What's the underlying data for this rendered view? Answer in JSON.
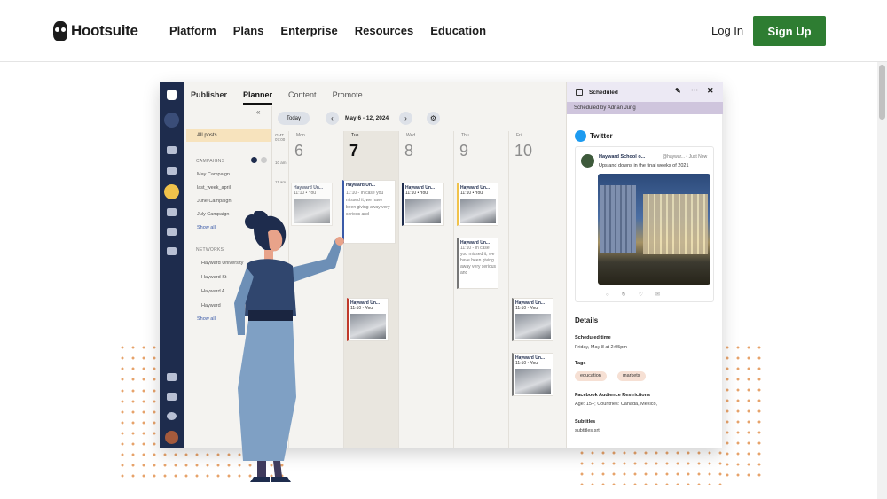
{
  "nav": {
    "brand": "Hootsuite",
    "links": [
      "Platform",
      "Plans",
      "Enterprise",
      "Resources",
      "Education"
    ],
    "login": "Log In",
    "signup": "Sign Up"
  },
  "colors": {
    "signup": "#2e7d32",
    "rail": "#1e2c4d",
    "accent_dots": "#e7a36b",
    "selected": "#f7e3bd"
  },
  "app": {
    "tabs": [
      "Publisher",
      "Planner",
      "Content",
      "Promote"
    ],
    "active_tab": "Planner",
    "toolbar": {
      "today": "Today",
      "range": "May 6 - 12, 2024"
    },
    "left": {
      "all_posts": "All posts",
      "campaigns_heading": "CAMPAIGNS",
      "campaigns": [
        "May Campaign",
        "last_week_april",
        "June Campaign",
        "July Campaign"
      ],
      "show_all_1": "Show all",
      "networks_heading": "NETWORKS",
      "networks": [
        "Hayward University",
        "Hayward St",
        "Hayward A",
        "Hayward"
      ],
      "show_all_2": "Show all"
    },
    "gmt": "GMT 07:00",
    "times": [
      "10 am",
      "11 am"
    ],
    "days": [
      {
        "name": "Mon",
        "num": "6"
      },
      {
        "name": "Tue",
        "num": "7"
      },
      {
        "name": "Wed",
        "num": "8"
      },
      {
        "name": "Thu",
        "num": "9"
      },
      {
        "name": "Fri",
        "num": "10"
      }
    ],
    "card_title": "Hayward Un...",
    "card_time": "11:10 • You",
    "card_text": "11:10 - In case you missed it, we have been giving away very serious and",
    "right": {
      "header": "Scheduled",
      "scheduled_by": "Scheduled by Adrian Jung",
      "network": "Twitter",
      "tweet_name": "Hayward School o...",
      "tweet_handle": "@haywar... • Just Now",
      "tweet_text": "Ups and downs in the final weeks of 2021",
      "details": "Details",
      "scheduled_time_label": "Scheduled time",
      "scheduled_time": "Friday, May 8 at 2:05pm",
      "tags_label": "Tags",
      "tags": [
        "education",
        "markets"
      ],
      "restrictions_label": "Facebook Audience Restrictions",
      "restrictions": "Age: 15+; Countries: Canada, Mexico,",
      "subtitles_label": "Subtitles",
      "subtitles": "subtitles.srt"
    }
  }
}
